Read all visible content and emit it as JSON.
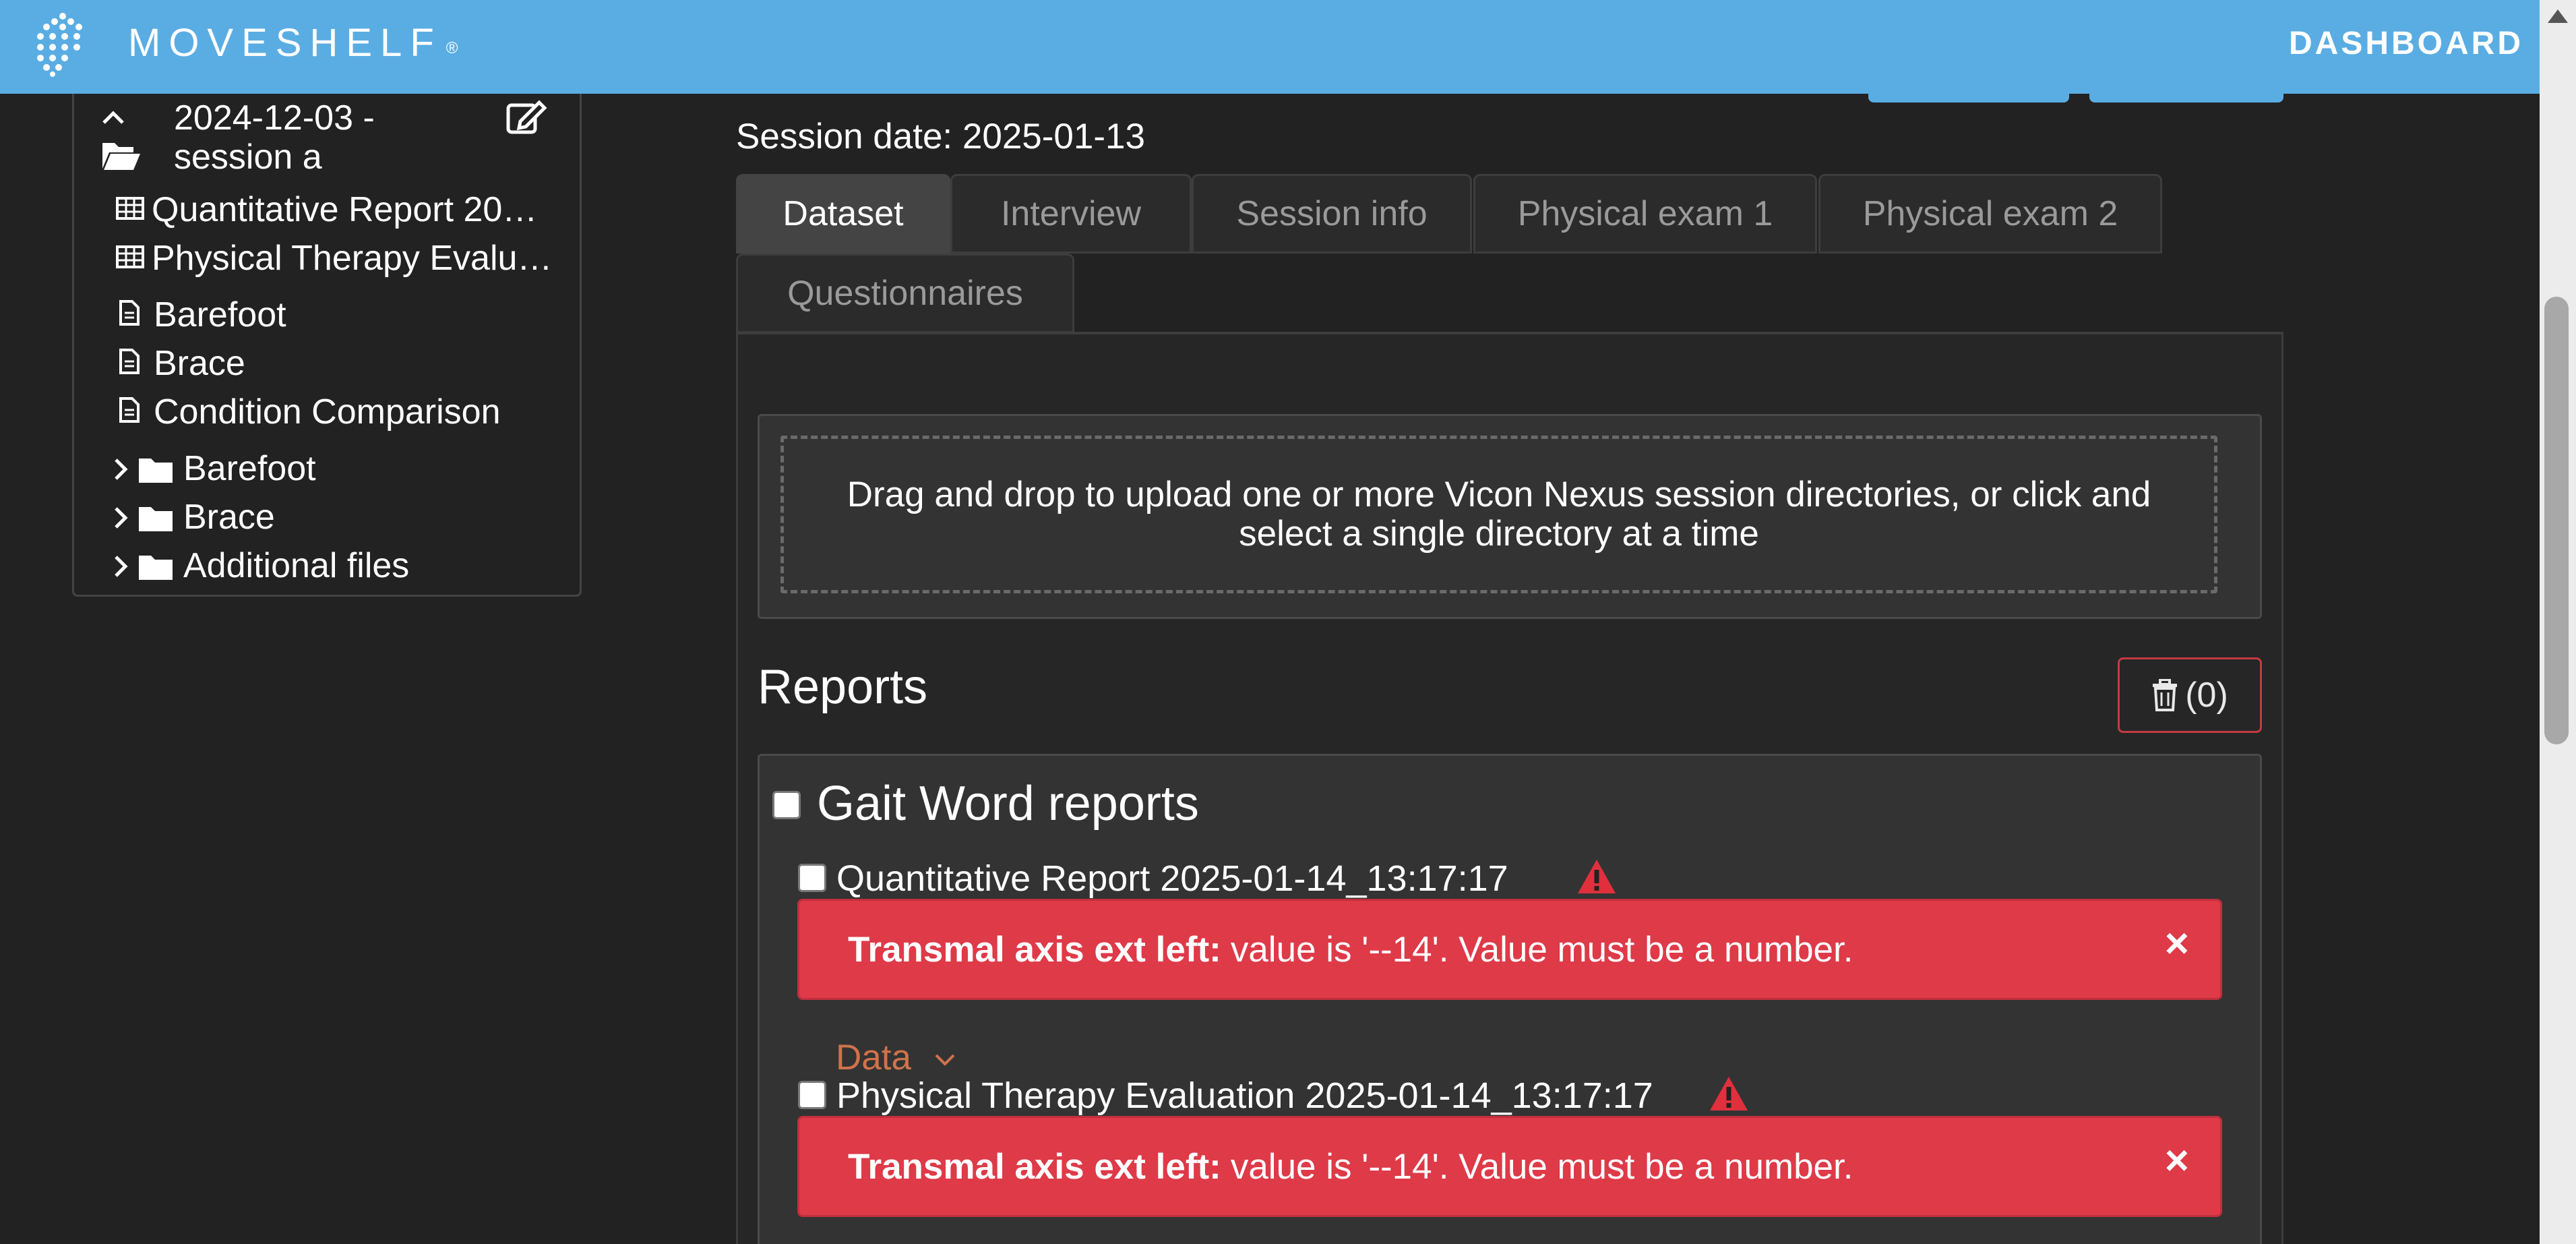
{
  "header": {
    "brand": "MOVESHELF",
    "brand_mark": "®",
    "dashboard": "DASHBOARD"
  },
  "sidebar": {
    "session_date_line": "2024-12-03 -",
    "session_name_line": "session a",
    "reports": [
      {
        "label": "Quantitative Report 20…",
        "icon": "table-icon"
      },
      {
        "label": "Physical Therapy Evalu…",
        "icon": "table-icon"
      }
    ],
    "documents": [
      {
        "label": "Barefoot",
        "icon": "document-icon"
      },
      {
        "label": "Brace",
        "icon": "document-icon"
      },
      {
        "label": "Condition Comparison",
        "icon": "document-icon"
      }
    ],
    "folders": [
      {
        "label": "Barefoot",
        "icon": "folder-icon"
      },
      {
        "label": "Brace",
        "icon": "folder-icon"
      },
      {
        "label": "Additional files",
        "icon": "folder-icon"
      }
    ]
  },
  "main": {
    "session_date": "Session date: 2025-01-13",
    "tabs": [
      {
        "label": "Dataset",
        "active": true
      },
      {
        "label": "Interview",
        "active": false
      },
      {
        "label": "Session info",
        "active": false
      },
      {
        "label": "Physical exam 1",
        "active": false
      },
      {
        "label": "Physical exam 2",
        "active": false
      },
      {
        "label": "Questionnaires",
        "active": false
      }
    ],
    "dropzone_text": "Drag and drop to upload one or more Vicon Nexus session directories, or click and select a single directory at a time",
    "reports_title": "Reports",
    "trash_count": "(0)",
    "gait_title": "Gait Word reports",
    "report_items": [
      {
        "title": "Quantitative Report 2025-01-14_13:17:17",
        "alert_label": "Transmal axis ext left:",
        "alert_text": "value is '--14'. Value must be a number."
      },
      {
        "title": "Physical Therapy Evaluation 2025-01-14_13:17:17",
        "alert_label": "Transmal axis ext left:",
        "alert_text": "value is '--14'. Value must be a number."
      }
    ],
    "data_toggle": "Data",
    "alert_close": "×"
  },
  "colors": {
    "header": "#5aade3",
    "background": "#222222",
    "alert": "#de3a48",
    "data_toggle": "#d0734a"
  }
}
